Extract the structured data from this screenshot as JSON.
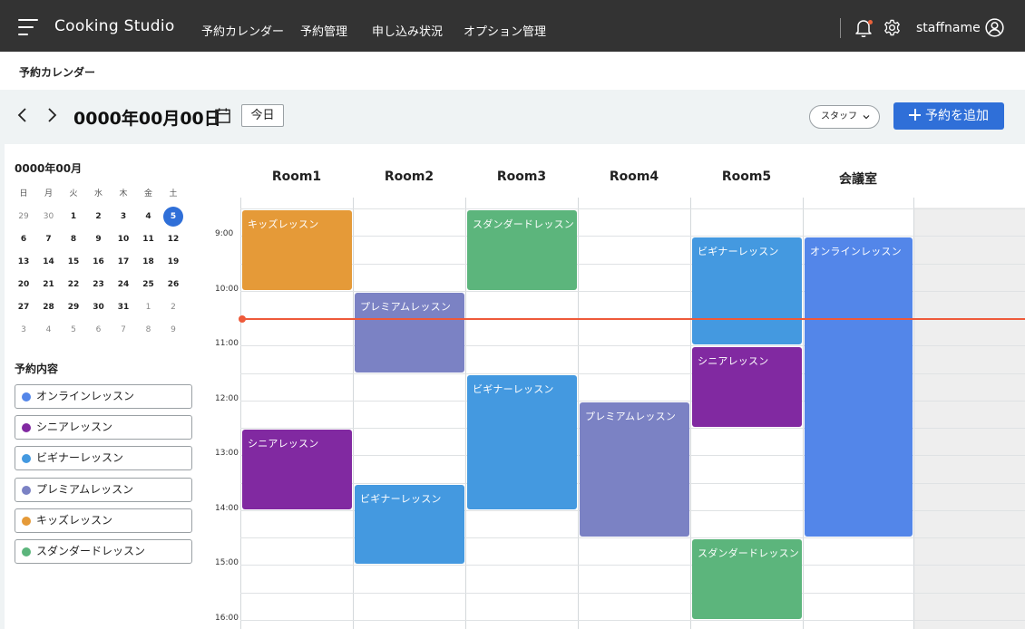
{
  "colors": {
    "online": "#5386e9",
    "senior": "#8129a1",
    "beginner": "#4499e0",
    "premium": "#7b82c4",
    "kids": "#e59a38",
    "standard": "#5cb57c",
    "primary": "#2f6fd8",
    "now_line": "#ee5a3a"
  },
  "header": {
    "app_title": "Cooking Studio",
    "nav": [
      "予約カレンダー",
      "予約管理",
      "申し込み状況",
      "オプション管理"
    ],
    "user_name": "staffname"
  },
  "breadcrumb": "予約カレンダー",
  "toolbar": {
    "date": "0000年00月00日",
    "today_label": "今日",
    "staff_select": "スタッフ",
    "add_label": "予約を追加"
  },
  "mini_calendar": {
    "title": "0000年00月",
    "weekdays": [
      "日",
      "月",
      "火",
      "水",
      "木",
      "金",
      "土"
    ],
    "weeks": [
      [
        "29",
        "30",
        "1",
        "2",
        "3",
        "4",
        "5"
      ],
      [
        "6",
        "7",
        "8",
        "9",
        "10",
        "11",
        "12"
      ],
      [
        "13",
        "14",
        "15",
        "16",
        "17",
        "18",
        "19"
      ],
      [
        "20",
        "21",
        "22",
        "23",
        "24",
        "25",
        "26"
      ],
      [
        "27",
        "28",
        "29",
        "30",
        "31",
        "1",
        "2"
      ],
      [
        "3",
        "4",
        "5",
        "6",
        "7",
        "8",
        "9"
      ]
    ],
    "selected": "5"
  },
  "legend": {
    "title": "予約内容",
    "items": [
      {
        "label": "オンラインレッスン",
        "color": "#5386e9"
      },
      {
        "label": "シニアレッスン",
        "color": "#8129a1"
      },
      {
        "label": "ビギナーレッスン",
        "color": "#4499e0"
      },
      {
        "label": "プレミアムレッスン",
        "color": "#7b82c4"
      },
      {
        "label": "キッズレッスン",
        "color": "#e59a38"
      },
      {
        "label": "スダンダードレッスン",
        "color": "#5cb57c"
      }
    ]
  },
  "calendar": {
    "rooms": [
      "Room1",
      "Room2",
      "Room3",
      "Room4",
      "Room5",
      "会議室"
    ],
    "times": [
      "9:00",
      "10:00",
      "11:00",
      "12:00",
      "13:00",
      "14:00",
      "15:00",
      "16:00"
    ],
    "now": "11:00",
    "events": [
      {
        "room": "Room1",
        "title": "キッズレッスン",
        "start": "9:00",
        "end": "10:30",
        "color": "#e59a38"
      },
      {
        "room": "Room1",
        "title": "シニアレッスン",
        "start": "13:00",
        "end": "14:30",
        "color": "#8129a1"
      },
      {
        "room": "Room2",
        "title": "プレミアムレッスン",
        "start": "10:30",
        "end": "12:00",
        "color": "#7b82c4"
      },
      {
        "room": "Room2",
        "title": "ビギナーレッスン",
        "start": "14:00",
        "end": "15:30",
        "color": "#4499e0"
      },
      {
        "room": "Room3",
        "title": "スダンダードレッスン",
        "start": "9:00",
        "end": "10:30",
        "color": "#5cb57c"
      },
      {
        "room": "Room3",
        "title": "ビギナーレッスン",
        "start": "12:00",
        "end": "14:30",
        "color": "#4499e0"
      },
      {
        "room": "Room4",
        "title": "プレミアムレッスン",
        "start": "12:30",
        "end": "15:00",
        "color": "#7b82c4"
      },
      {
        "room": "Room5",
        "title": "ビギナーレッスン",
        "start": "9:30",
        "end": "11:30",
        "color": "#4499e0"
      },
      {
        "room": "Room5",
        "title": "シニアレッスン",
        "start": "11:30",
        "end": "13:00",
        "color": "#8129a1"
      },
      {
        "room": "Room5",
        "title": "スダンダードレッスン",
        "start": "15:00",
        "end": "16:30",
        "color": "#5cb57c"
      },
      {
        "room": "会議室",
        "title": "オンラインレッスン",
        "start": "9:30",
        "end": "15:00",
        "color": "#5386e9"
      }
    ]
  }
}
